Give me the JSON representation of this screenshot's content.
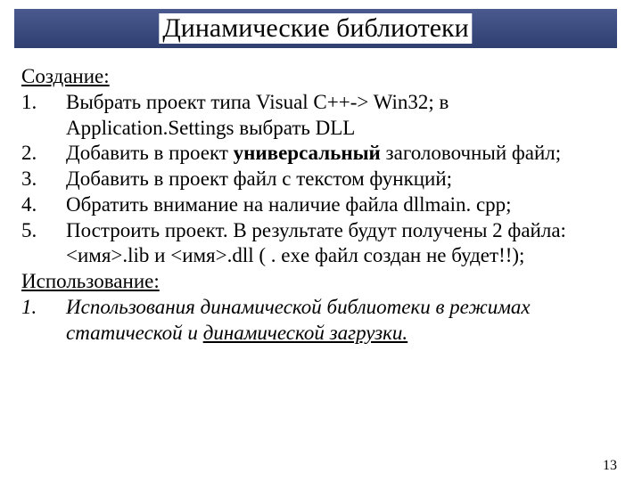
{
  "title": "Динамические библиотеки",
  "section_creation": "Создание:",
  "items": [
    {
      "n": "1.",
      "pre": "Выбрать проект типа Visual C++-> Win32; в Application.Settings выбрать DLL"
    },
    {
      "n": "2.",
      "pre": "Добавить в проект ",
      "bold": "универсальный",
      "post": " заголовочный файл;"
    },
    {
      "n": "3.",
      "pre": "Добавить в проект файл с текстом функций;"
    },
    {
      "n": "4.",
      "pre": "Обратить внимание на наличие файла dllmain. cpp;"
    },
    {
      "n": "5.",
      "pre": "Построить проект. В результате будут получены 2 файла: <имя>.lib   и  <имя>.dll    ( . exe файл создан не будет!!);"
    }
  ],
  "section_usage": "Использование:",
  "usage_item": {
    "n": "1.",
    "lead": "Использования динамической библиотеки в режимах статической и ",
    "tail": "динамической загрузки."
  },
  "page_number": "13"
}
